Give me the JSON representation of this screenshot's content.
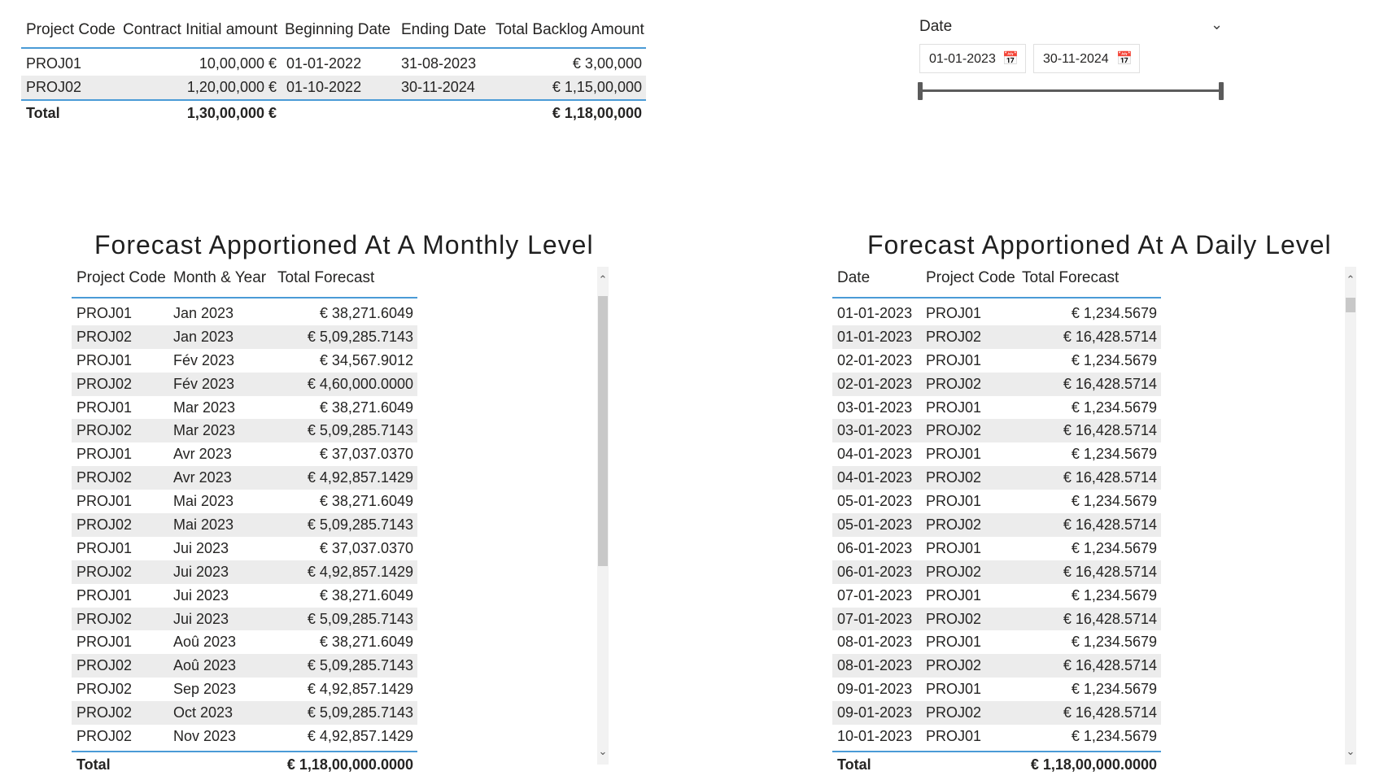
{
  "project_table": {
    "headers": [
      "Project Code",
      "Contract Initial amount",
      "Beginning Date",
      "Ending Date",
      "Total Backlog Amount"
    ],
    "rows": [
      [
        "PROJ01",
        "10,00,000 €",
        "01-01-2022",
        "31-08-2023",
        "€ 3,00,000"
      ],
      [
        "PROJ02",
        "1,20,00,000 €",
        "01-10-2022",
        "30-11-2024",
        "€ 1,15,00,000"
      ]
    ],
    "total": [
      "Total",
      "1,30,00,000 €",
      "",
      "",
      "€ 1,18,00,000"
    ]
  },
  "slicer": {
    "title": "Date",
    "start": "01-01-2023",
    "end": "30-11-2024",
    "range_start_fraction": 0,
    "range_end_fraction": 1
  },
  "monthly": {
    "title": "Forecast Apportioned At A Monthly Level",
    "headers": [
      "Project Code",
      "Month & Year",
      "Total Forecast"
    ],
    "rows": [
      [
        "PROJ01",
        "Jan 2023",
        "€ 38,271.6049"
      ],
      [
        "PROJ02",
        "Jan 2023",
        "€ 5,09,285.7143"
      ],
      [
        "PROJ01",
        "Fév 2023",
        "€ 34,567.9012"
      ],
      [
        "PROJ02",
        "Fév 2023",
        "€ 4,60,000.0000"
      ],
      [
        "PROJ01",
        "Mar 2023",
        "€ 38,271.6049"
      ],
      [
        "PROJ02",
        "Mar 2023",
        "€ 5,09,285.7143"
      ],
      [
        "PROJ01",
        "Avr 2023",
        "€ 37,037.0370"
      ],
      [
        "PROJ02",
        "Avr 2023",
        "€ 4,92,857.1429"
      ],
      [
        "PROJ01",
        "Mai 2023",
        "€ 38,271.6049"
      ],
      [
        "PROJ02",
        "Mai 2023",
        "€ 5,09,285.7143"
      ],
      [
        "PROJ01",
        "Jui 2023",
        "€ 37,037.0370"
      ],
      [
        "PROJ02",
        "Jui 2023",
        "€ 4,92,857.1429"
      ],
      [
        "PROJ01",
        "Jui 2023",
        "€ 38,271.6049"
      ],
      [
        "PROJ02",
        "Jui 2023",
        "€ 5,09,285.7143"
      ],
      [
        "PROJ01",
        "Aoû 2023",
        "€ 38,271.6049"
      ],
      [
        "PROJ02",
        "Aoû 2023",
        "€ 5,09,285.7143"
      ],
      [
        "PROJ02",
        "Sep 2023",
        "€ 4,92,857.1429"
      ],
      [
        "PROJ02",
        "Oct 2023",
        "€ 5,09,285.7143"
      ],
      [
        "PROJ02",
        "Nov 2023",
        "€ 4,92,857.1429"
      ]
    ],
    "total": [
      "Total",
      "",
      "€ 1,18,00,000.0000"
    ]
  },
  "daily": {
    "title": "Forecast Apportioned At A Daily Level",
    "headers": [
      "Date",
      "Project Code",
      "Total Forecast"
    ],
    "rows": [
      [
        "01-01-2023",
        "PROJ01",
        "€ 1,234.5679"
      ],
      [
        "01-01-2023",
        "PROJ02",
        "€ 16,428.5714"
      ],
      [
        "02-01-2023",
        "PROJ01",
        "€ 1,234.5679"
      ],
      [
        "02-01-2023",
        "PROJ02",
        "€ 16,428.5714"
      ],
      [
        "03-01-2023",
        "PROJ01",
        "€ 1,234.5679"
      ],
      [
        "03-01-2023",
        "PROJ02",
        "€ 16,428.5714"
      ],
      [
        "04-01-2023",
        "PROJ01",
        "€ 1,234.5679"
      ],
      [
        "04-01-2023",
        "PROJ02",
        "€ 16,428.5714"
      ],
      [
        "05-01-2023",
        "PROJ01",
        "€ 1,234.5679"
      ],
      [
        "05-01-2023",
        "PROJ02",
        "€ 16,428.5714"
      ],
      [
        "06-01-2023",
        "PROJ01",
        "€ 1,234.5679"
      ],
      [
        "06-01-2023",
        "PROJ02",
        "€ 16,428.5714"
      ],
      [
        "07-01-2023",
        "PROJ01",
        "€ 1,234.5679"
      ],
      [
        "07-01-2023",
        "PROJ02",
        "€ 16,428.5714"
      ],
      [
        "08-01-2023",
        "PROJ01",
        "€ 1,234.5679"
      ],
      [
        "08-01-2023",
        "PROJ02",
        "€ 16,428.5714"
      ],
      [
        "09-01-2023",
        "PROJ01",
        "€ 1,234.5679"
      ],
      [
        "09-01-2023",
        "PROJ02",
        "€ 16,428.5714"
      ],
      [
        "10-01-2023",
        "PROJ01",
        "€ 1,234.5679"
      ]
    ],
    "total": [
      "Total",
      "",
      "€ 1,18,00,000.0000"
    ]
  },
  "icons": {
    "chevron": "chevron-down-icon",
    "calendar": "calendar-icon",
    "scroll_up": "scroll-up-icon",
    "scroll_down": "scroll-down-icon"
  },
  "colors": {
    "accent_line": "#4a9bd6",
    "alt_row": "#ececec"
  }
}
